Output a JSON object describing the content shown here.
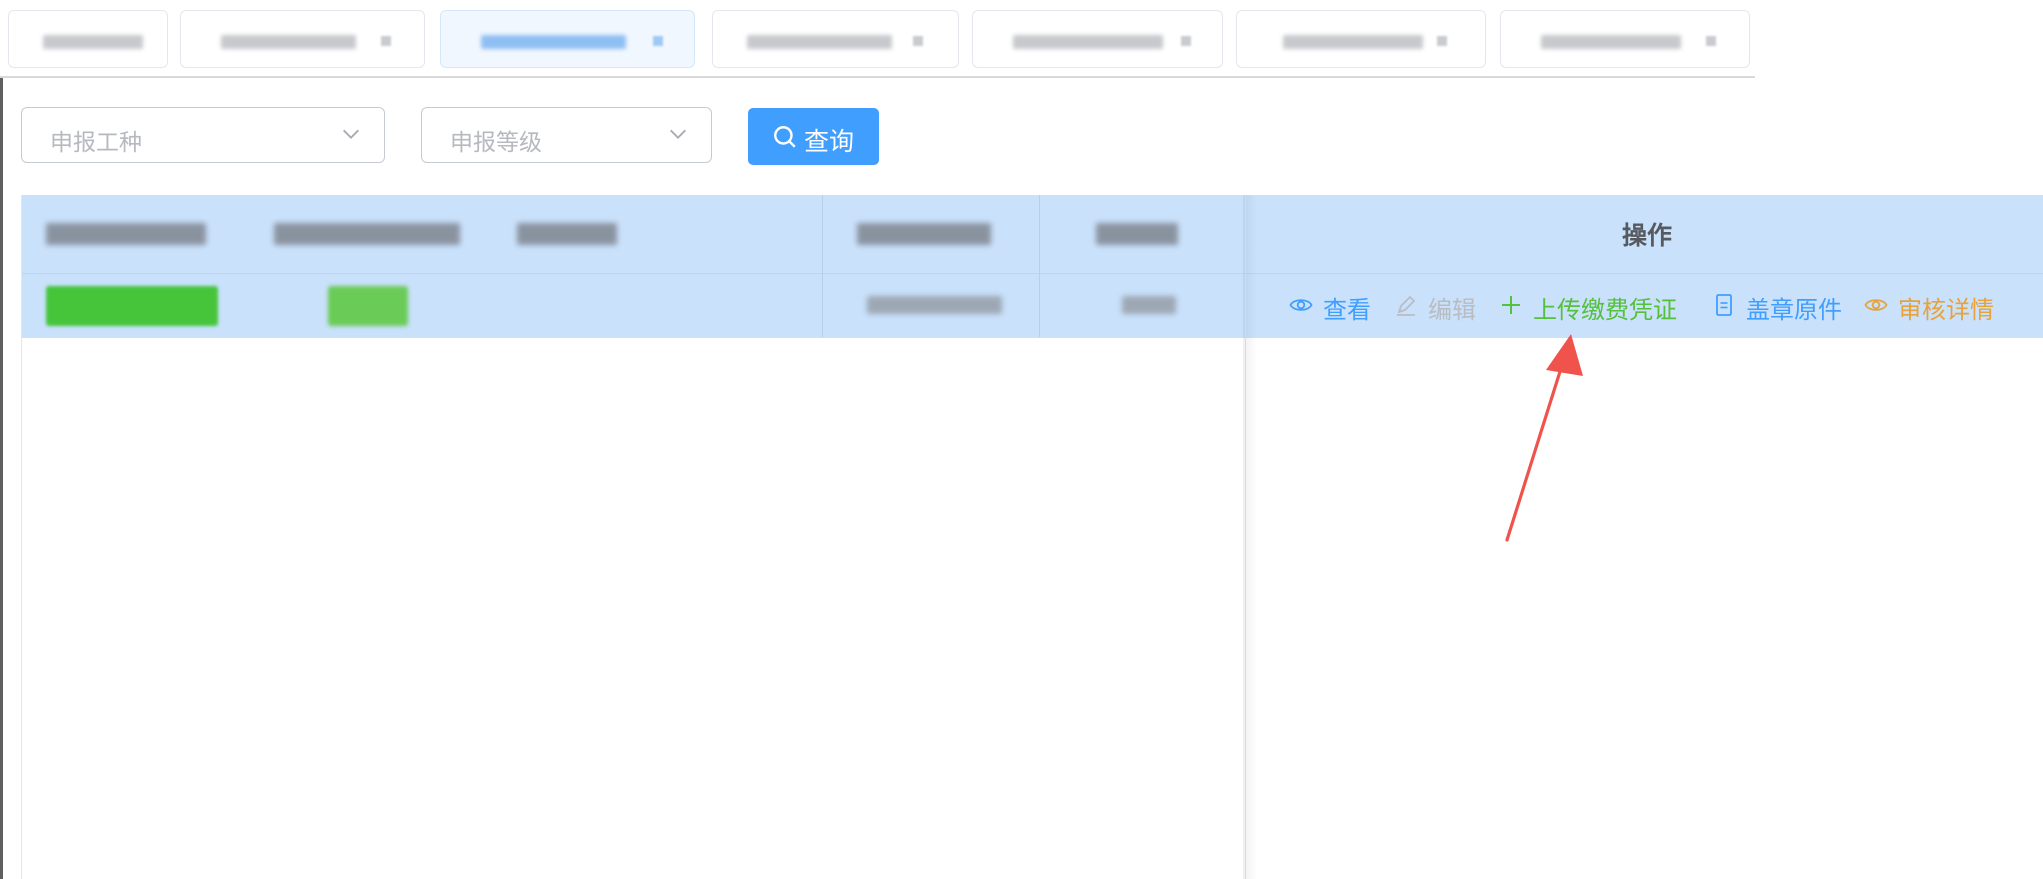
{
  "filters": {
    "job_type_placeholder": "申报工种",
    "level_placeholder": "申报等级",
    "query_label": "查询"
  },
  "table": {
    "operation_header": "操作",
    "row_actions": {
      "view": "查看",
      "edit": "编辑",
      "upload_payment": "上传缴费凭证",
      "sealed_original": "盖章原件",
      "review_details": "审核详情"
    }
  },
  "colors": {
    "primary": "#409eff",
    "success": "#54c03b",
    "warning": "#e6a23c",
    "disabled": "#b9bcc2",
    "header_bg": "#c9e1fb",
    "annotation_arrow": "#f0524c"
  },
  "icons": {
    "select_chevron": "chevron-down-icon",
    "query": "search-icon",
    "view": "eye-icon",
    "edit": "pencil-icon",
    "upload": "plus-icon",
    "seal": "document-icon",
    "detail": "eye-icon"
  }
}
